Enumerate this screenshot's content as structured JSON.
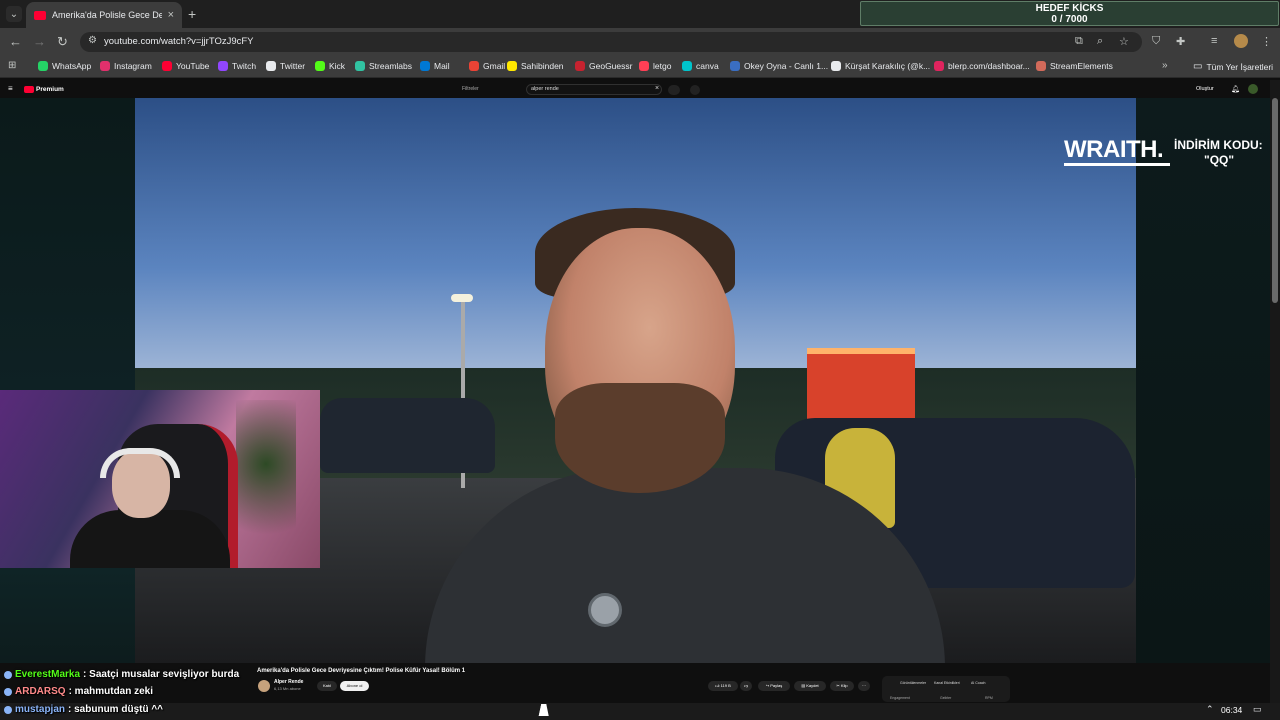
{
  "overlay": {
    "goal_title": "HEDEF KİCKS",
    "goal_progress": "0 / 7000",
    "sponsor_brand": "WRAITH.",
    "sponsor_text": "İNDİRİM KODU:",
    "sponsor_code": "\"QQ\""
  },
  "browser": {
    "tab_title": "Amerika'da Polisle Gece Devriye",
    "url": "youtube.com/watch?v=jjrTOzJ9cFY",
    "bookmarks": [
      {
        "label": "WhatsApp",
        "color": "#25d366"
      },
      {
        "label": "Instagram",
        "color": "#e1306c"
      },
      {
        "label": "YouTube",
        "color": "#ff0033"
      },
      {
        "label": "Twitch",
        "color": "#9146ff"
      },
      {
        "label": "Twitter",
        "color": "#e8eaed"
      },
      {
        "label": "Kick",
        "color": "#53fc18"
      },
      {
        "label": "Streamlabs",
        "color": "#31c3a2"
      },
      {
        "label": "Mail",
        "color": "#0078d4"
      },
      {
        "label": "Gmail",
        "color": "#ea4335"
      },
      {
        "label": "Sahibinden",
        "color": "#ffe800"
      },
      {
        "label": "GeoGuessr",
        "color": "#c6222f"
      },
      {
        "label": "letgo",
        "color": "#ff3f55"
      },
      {
        "label": "canva",
        "color": "#00c4cc"
      },
      {
        "label": "Okey Oyna - Canlı 1...",
        "color": "#3a6ec2"
      },
      {
        "label": "Kürşat Karakılıç (@k...",
        "color": "#e8eaed"
      },
      {
        "label": "blerp.com/dashboar...",
        "color": "#e0245e"
      },
      {
        "label": "StreamElements",
        "color": "#d26a5a"
      }
    ],
    "all_bookmarks": "Tüm Yer İşaretleri"
  },
  "youtube": {
    "premium": "Premium",
    "filter": "Filtreler",
    "search_value": "alper rende",
    "create": "Oluştur",
    "video_title": "Amerika'da Polisle Gece Devriyesine Çıktım! Polise Küfür Yasal! Bölüm 1",
    "channel_name": "Alper Rende",
    "channel_subs": "6,13 Mn abone",
    "join": "Katıl",
    "subscribe": "Abone ol",
    "likes": "119 B",
    "share": "Paylaş",
    "save": "Kaydet",
    "clip": "Klip",
    "chips": [
      "Görüntülenmeler",
      "Kanal Etkinlikleri",
      "AI Coach"
    ],
    "chips2": [
      "Engagement",
      "Gelirler",
      "RPM"
    ]
  },
  "chat": [
    {
      "user": "EverestMarka",
      "message": ": Saatçi musalar sevişliyor burda"
    },
    {
      "user": "ARDARSQ",
      "message": ": mahmutdan zeki"
    },
    {
      "user": "mustapjan",
      "message": ": sabunum düştü ^^"
    }
  ],
  "taskbar": {
    "clock": "06:34"
  }
}
